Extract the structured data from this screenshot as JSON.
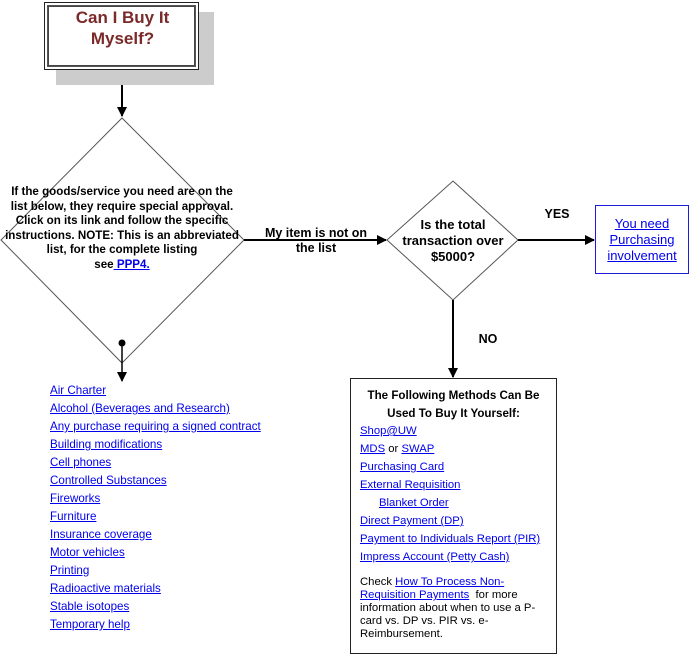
{
  "title_box": {
    "text": "Can I Buy It Myself?",
    "color": "#7b2a2a"
  },
  "decision_1": {
    "text": "If the goods/service you need are on the list below, they require special approval. Click on its link and follow the specific instructions. NOTE:  This is an abbreviated list, for the complete listing",
    "see_prefix": "see",
    "link_label": " PPP4."
  },
  "edge_not_on_list": {
    "label": "My item is not on the list"
  },
  "decision_2": {
    "text": "Is the total transaction over $5000?"
  },
  "edge_yes": {
    "label": "YES"
  },
  "edge_no": {
    "label": "NO"
  },
  "purchasing_box": {
    "link_label": "You need Purchasing involvement",
    "border_color": "#1b1bd8"
  },
  "restricted_items": [
    "Air Charter",
    "Alcohol  (Beverages and Research)",
    "Any purchase requiring a signed contract",
    "Building modifications",
    "Cell phones",
    "Controlled Substances",
    "Fireworks",
    "Furniture",
    "Insurance coverage",
    "Motor vehicles",
    "Printing",
    "Radioactive materials",
    "Stable isotopes",
    "Temporary help"
  ],
  "methods_box": {
    "title": "The Following Methods Can Be Used To Buy It Yourself:",
    "shop_uw": "Shop@UW",
    "mds": "MDS",
    "or_text": " or ",
    "swap": "SWAP",
    "purchasing_card": "Purchasing Card",
    "external_requisition": "External Requisition",
    "blanket_order": "Blanket Order",
    "direct_payment": "Direct Payment (DP)",
    "pir": "Payment to Individuals Report (PIR)",
    "imprest": "Impress Account (Petty Cash)",
    "note_prefix": "Check ",
    "note_link": "How To Process Non-Requisition Payments",
    "note_suffix": "  for more information about when to use a P-card vs. DP vs. PIR vs. e-Reimbursement."
  },
  "colors": {
    "link": "#0000ee",
    "shadow": "#cccccc",
    "line": "#000000"
  }
}
